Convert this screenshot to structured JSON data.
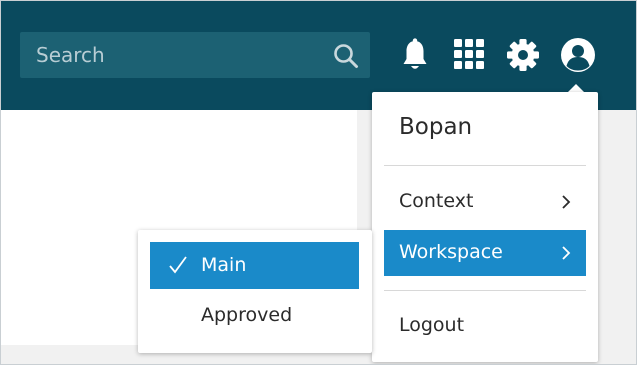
{
  "header": {
    "search": {
      "placeholder": "Search",
      "value": ""
    },
    "icons": [
      "search-icon",
      "bell-icon",
      "apps-grid-icon",
      "gear-icon",
      "user-avatar-icon"
    ]
  },
  "user_menu": {
    "username": "Bopan",
    "items": [
      {
        "label": "Context",
        "has_submenu": true,
        "active": false
      },
      {
        "label": "Workspace",
        "has_submenu": true,
        "active": true
      },
      {
        "label": "Logout",
        "has_submenu": false,
        "active": false
      }
    ]
  },
  "workspace_submenu": {
    "items": [
      {
        "label": "Main",
        "selected": true
      },
      {
        "label": "Approved",
        "selected": false
      }
    ]
  },
  "colors": {
    "topbar": "#0a4a5e",
    "search_bg": "#1c6173",
    "accent": "#1a8ac9",
    "icon": "#ffffff",
    "text": "#2b2b2b"
  }
}
